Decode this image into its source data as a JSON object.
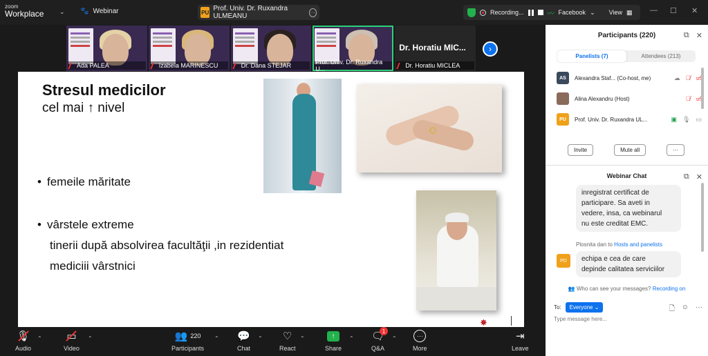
{
  "app": {
    "logo_top": "zoom",
    "logo_bottom": "Workplace",
    "mode": "Webinar"
  },
  "active_speaker": {
    "initials": "PU",
    "name": "Prof. Univ. Dr. Ruxandra ULMEANU"
  },
  "recording": {
    "label": "Recording...",
    "live": "Facebook",
    "view": "View"
  },
  "video_strip": [
    {
      "name": "Ada PALEA",
      "muted": true
    },
    {
      "name": "Izabela MARINESCU",
      "muted": true
    },
    {
      "name": "Dr. Dana STEJAR",
      "muted": true
    },
    {
      "name": "Prof. Univ. Dr. Ruxandra U...",
      "muted": false,
      "active": true
    },
    {
      "name": "Dr. Horatiu MICLEA",
      "big_label": "Dr. Horatiu MIC...",
      "muted": true
    }
  ],
  "slide": {
    "title": "Stresul medicilor",
    "subtitle": "cel mai ↑ nivel",
    "bullet1": "femeile măritate",
    "bullet2": "vârstele extreme",
    "line1": "tinerii după absolvirea facultăţii ,in rezidentiat",
    "line2": "mediciii  vârstnici"
  },
  "toolbar": {
    "audio": "Audio",
    "video": "Video",
    "participants": "Participants",
    "participants_count": "220",
    "chat": "Chat",
    "react": "React",
    "share": "Share",
    "qa": "Q&A",
    "qa_badge": "1",
    "more": "More",
    "leave": "Leave"
  },
  "participants_panel": {
    "title": "Participants (220)",
    "tab_panelists": "Panelists (7)",
    "tab_attendees": "Attendees (213)",
    "rows": [
      {
        "initials": "AS",
        "name": "Alexandra Staf... (Co-host, me)",
        "color": "#3a4a5c"
      },
      {
        "initials": "",
        "name": "Alina Alexandru (Host)",
        "color": "#8a6a5a"
      },
      {
        "initials": "PU",
        "name": "Prof. Univ. Dr. Ruxandra UL...",
        "color": "#f0a11a"
      }
    ],
    "invite": "Invite",
    "mute_all": "Mute all",
    "more": "···"
  },
  "chat_panel": {
    "title": "Webinar Chat",
    "msg1_lines": [
      "inregistrat certificat de",
      "participare. Sa aveti in",
      "vedere, insa, ca webinarul",
      "nu este creditat EMC."
    ],
    "sender_prefix": "Plosnita dan to",
    "sender_target": "Hosts and panelists",
    "sender_initials": "PD",
    "msg2_lines": [
      "echipa e cea de care",
      "depinde calitatea serviciilor"
    ],
    "who_prefix": "Who can see your messages?",
    "who_link": "Recording on",
    "to_label": "To:",
    "to_value": "Everyone",
    "placeholder": "Type message here..."
  }
}
